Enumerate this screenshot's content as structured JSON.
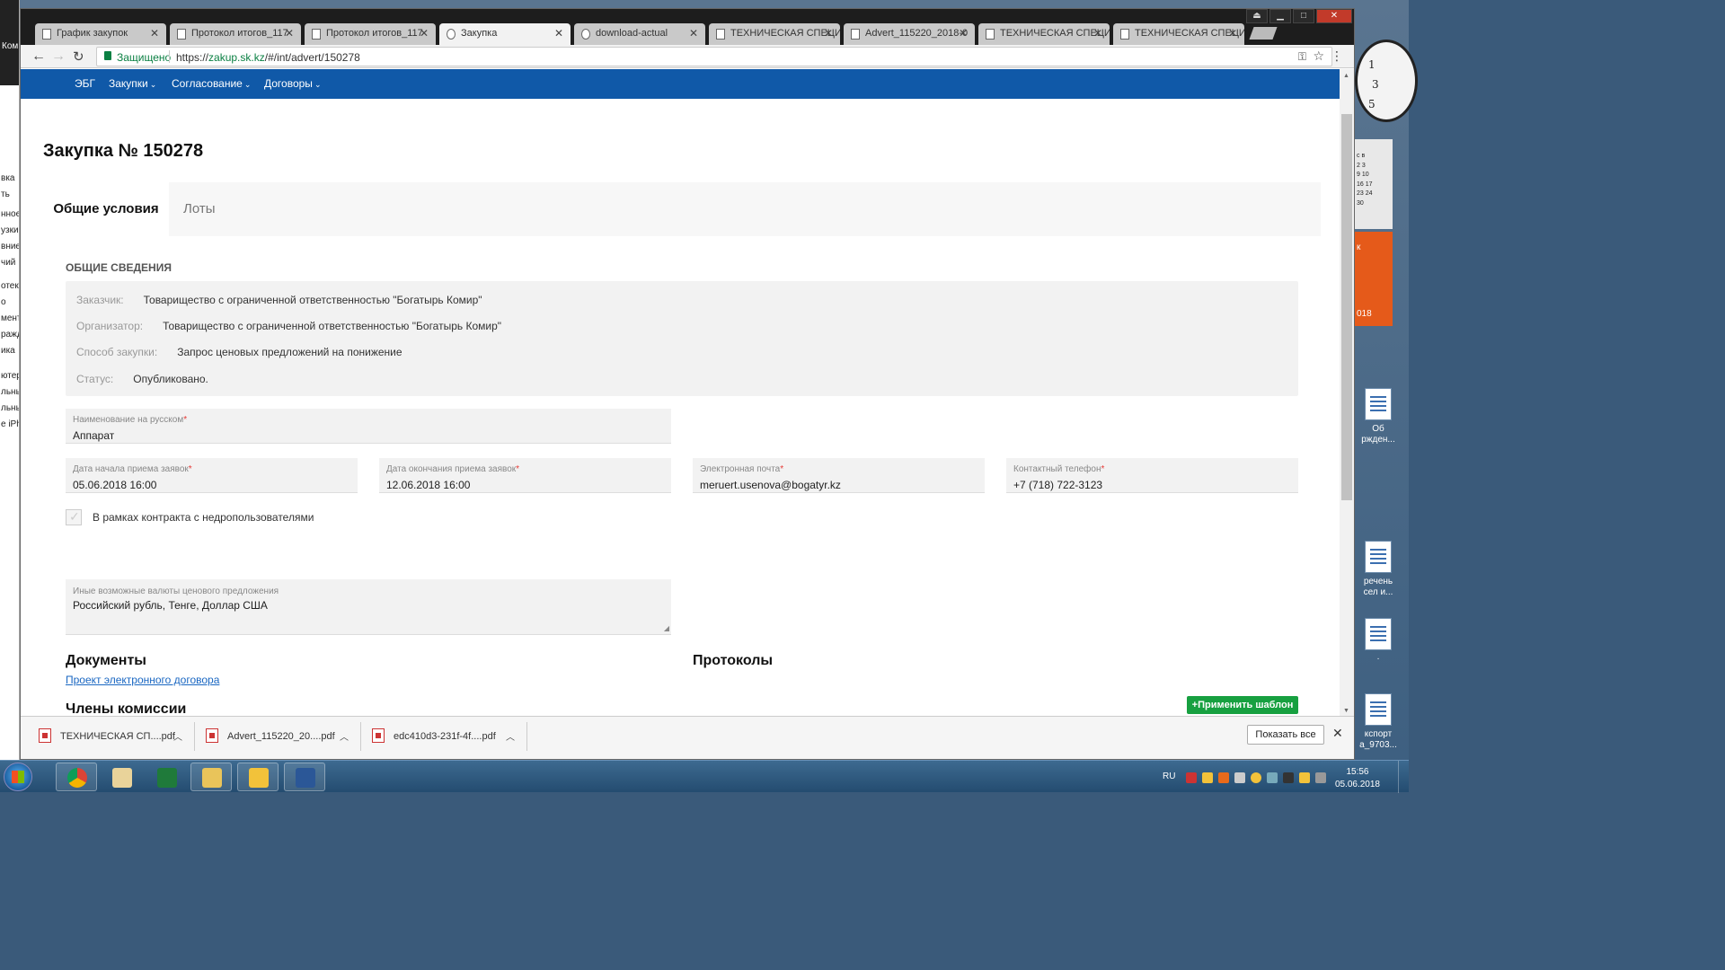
{
  "browser": {
    "tabs": [
      {
        "label": "График закупок"
      },
      {
        "label": "Протокол итогов_117"
      },
      {
        "label": "Протокол итогов_117"
      },
      {
        "label": "Закупка"
      },
      {
        "label": "download-actual"
      },
      {
        "label": "ТЕХНИЧЕСКАЯ СПЕЦИ"
      },
      {
        "label": "Advert_115220_2018-0"
      },
      {
        "label": "ТЕХНИЧЕСКАЯ СПЕЦИ"
      },
      {
        "label": "ТЕХНИЧЕСКАЯ СПЕЦИ"
      }
    ],
    "secure_label": "Защищено",
    "url_prefix": "https://",
    "url_host": "zakup.sk.kz",
    "url_path": "/#/int/advert/150278"
  },
  "nav": {
    "items": [
      {
        "label": "ЭБГ"
      },
      {
        "label": "Закупки"
      },
      {
        "label": "Согласование"
      },
      {
        "label": "Договоры"
      }
    ]
  },
  "page": {
    "title": "Закупка № 150278",
    "tabs": [
      {
        "label": "Общие условия"
      },
      {
        "label": "Лоты"
      }
    ],
    "section_label": "ОБЩИЕ СВЕДЕНИЯ",
    "info": [
      {
        "key": "Заказчик:",
        "value": "Товарищество с ограниченной ответственностью \"Богатырь Комир\""
      },
      {
        "key": "Организатор:",
        "value": "Товарищество с ограниченной ответственностью \"Богатырь Комир\""
      },
      {
        "key": "Способ закупки:",
        "value": "Запрос ценовых предложений на понижение"
      },
      {
        "key": "Статус:",
        "value": "Опубликовано."
      }
    ],
    "fields": {
      "name_ru": {
        "label": "Наименование на русском",
        "value": "Аппарат"
      },
      "start_date": {
        "label": "Дата начала приема заявок",
        "value": "05.06.2018 16:00"
      },
      "end_date": {
        "label": "Дата окончания приема заявок",
        "value": "12.06.2018 16:00"
      },
      "email": {
        "label": "Электронная почта",
        "value": "meruert.usenova@bogatyr.kz"
      },
      "phone": {
        "label": "Контактный телефон",
        "value": "+7 (718) 722-3123"
      },
      "currencies": {
        "label": "Иные возможные валюты ценового предложения",
        "value": "Российский  рубль, Тенге, Доллар США"
      }
    },
    "required_mark": "*",
    "checkbox_label": "В рамках контракта с недропользователями",
    "documents_heading": "Документы",
    "contract_link": "Проект электронного договора",
    "protocols_heading": "Протоколы",
    "commission_heading": "Члены комиссии",
    "apply_template_button": "+Применить шаблон"
  },
  "downloads": {
    "items": [
      {
        "name": "ТЕХНИЧЕСКАЯ СП....pdf"
      },
      {
        "name": "Advert_115220_20....pdf"
      },
      {
        "name": "edc410d3-231f-4f....pdf"
      }
    ],
    "show_all": "Показать все"
  },
  "taskbar": {
    "language": "RU",
    "time": "15:56",
    "date": "05.06.2018"
  },
  "desktop": {
    "left_labels": [
      "Ком",
      "вка",
      "ть",
      "нное",
      "узки",
      "вние",
      "чий",
      "отек",
      "о",
      "мент",
      "ражд",
      "ика",
      "ютер",
      "льны",
      "льны",
      "е iPh"
    ],
    "icons": [
      {
        "label_1": "Об",
        "label_2": "ржден..."
      },
      {
        "label_1": "речень",
        "label_2": "сел и..."
      },
      {
        "label_1": "·",
        "label_2": ""
      },
      {
        "label_1": "кспорт",
        "label_2": "а_9703..."
      }
    ],
    "gadget_text": "018"
  },
  "colors": {
    "nav_bg": "#1059a8",
    "link": "#1a67c2",
    "green_button": "#17a040",
    "required": "#e53935"
  }
}
